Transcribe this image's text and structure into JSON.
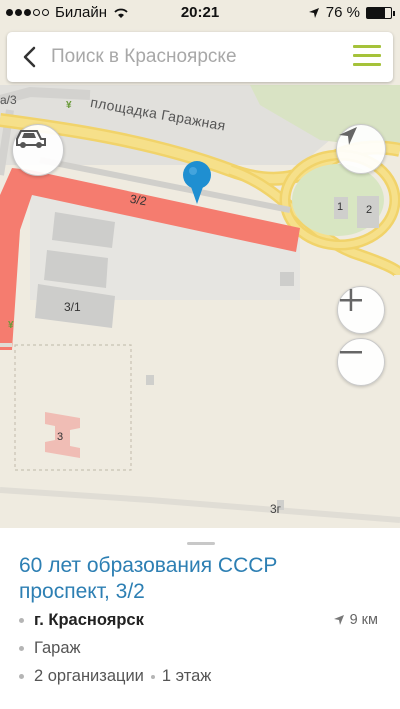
{
  "status_bar": {
    "carrier": "Билайн",
    "time": "20:21",
    "battery_percent_label": "76 %",
    "battery_level": 0.76,
    "signal_bars_filled": 3,
    "signal_bars_total": 5
  },
  "search": {
    "placeholder": "Поиск в Красноярске",
    "accent_color": "#a5c23a"
  },
  "map": {
    "street_label": "площадка Гаражная",
    "building_labels": {
      "main": "3/2",
      "b31": "3/1",
      "b3": "3",
      "b3g": "3г",
      "n1": "1",
      "n2": "2",
      "edge_a3": "а/3"
    },
    "controls": [
      "car-traffic",
      "locate",
      "zoom-in",
      "zoom-out"
    ]
  },
  "place": {
    "title": "60 лет образования СССР проспект, 3/2",
    "city": "г. Красноярск",
    "distance": "9 км",
    "category": "Гараж",
    "organizations": "2 организации",
    "floors": "1 этаж",
    "title_color": "#2d7fb3"
  }
}
